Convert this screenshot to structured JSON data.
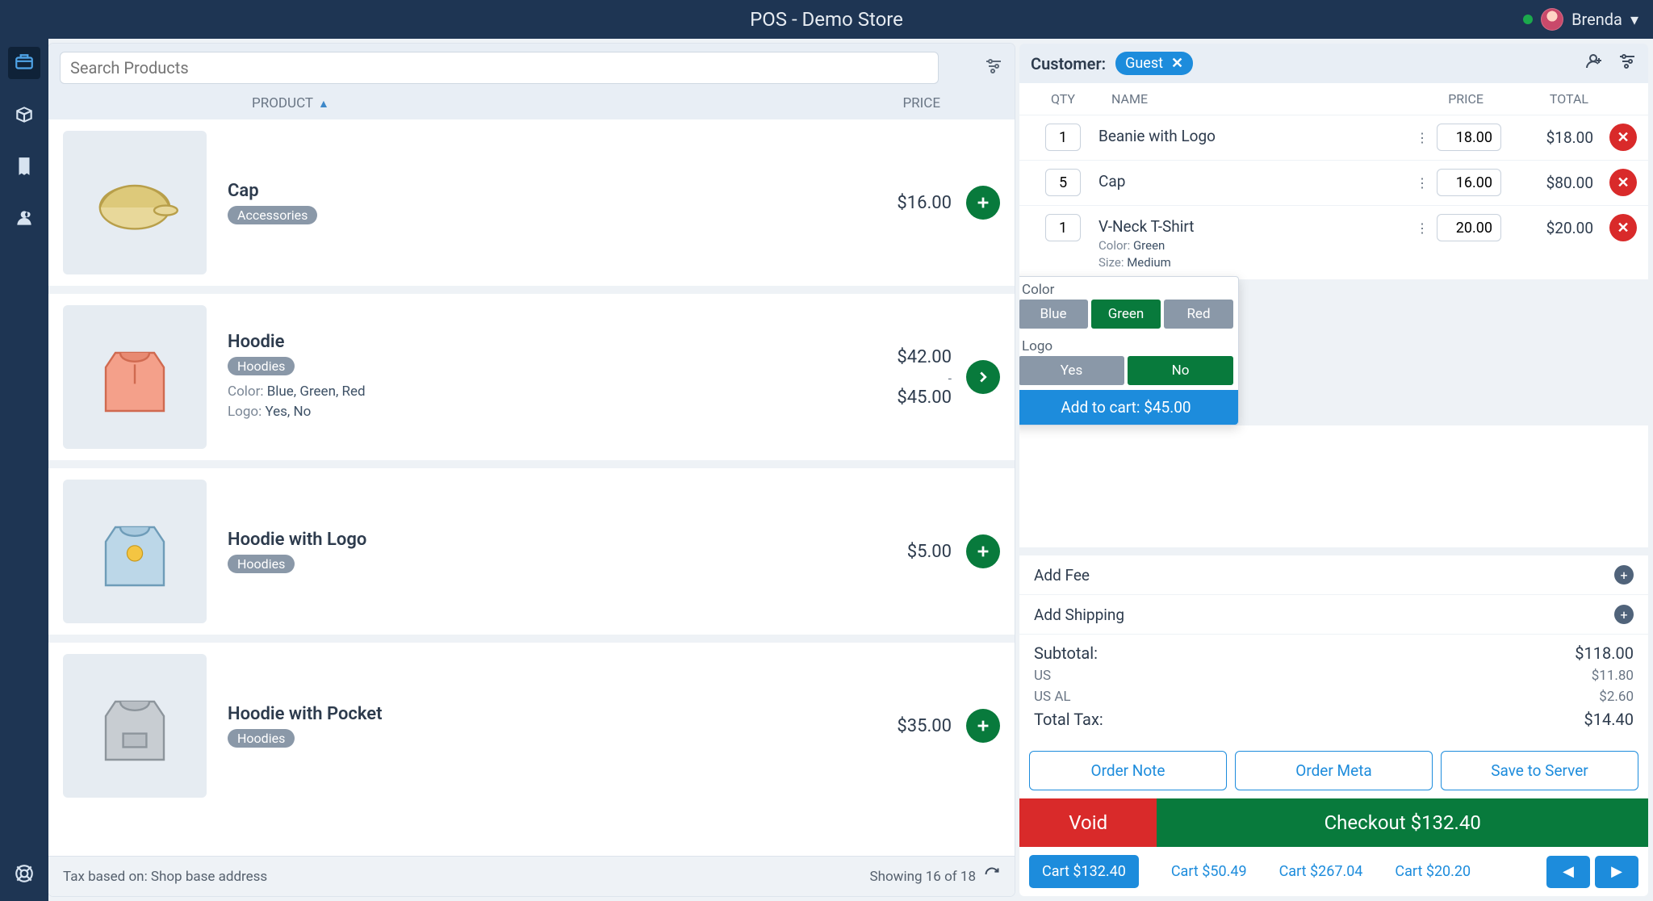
{
  "header": {
    "title": "POS - Demo Store",
    "user": "Brenda"
  },
  "search": {
    "placeholder": "Search Products"
  },
  "sort": {
    "product": "PRODUCT",
    "price": "PRICE"
  },
  "products": [
    {
      "name": "Cap",
      "tag": "Accessories",
      "price": "$16.00",
      "variants": null,
      "action": "add"
    },
    {
      "name": "Hoodie",
      "tag": "Hoodies",
      "price": "$42.00\n-\n$45.00",
      "variants": [
        {
          "label": "Color",
          "values": "Blue, Green, Red"
        },
        {
          "label": "Logo",
          "values": "Yes, No"
        }
      ],
      "action": "more"
    },
    {
      "name": "Hoodie with Logo",
      "tag": "Hoodies",
      "price": "$5.00",
      "variants": null,
      "action": "add"
    },
    {
      "name": "Hoodie with Pocket",
      "tag": "Hoodies",
      "price": "$35.00",
      "variants": null,
      "action": "add"
    }
  ],
  "footer": {
    "tax": "Tax based on: Shop base address",
    "showing": "Showing 16 of 18"
  },
  "customer": {
    "label": "Customer:",
    "name": "Guest"
  },
  "cart_cols": {
    "qty": "QTY",
    "name": "NAME",
    "price": "PRICE",
    "total": "TOTAL"
  },
  "cart_items": [
    {
      "qty": "1",
      "name": "Beanie with Logo",
      "sub": [],
      "price": "18.00",
      "total": "$18.00"
    },
    {
      "qty": "5",
      "name": "Cap",
      "sub": [],
      "price": "16.00",
      "total": "$80.00"
    },
    {
      "qty": "1",
      "name": "V-Neck T-Shirt",
      "sub": [
        {
          "k": "Color:",
          "v": "Green"
        },
        {
          "k": "Size:",
          "v": "Medium"
        }
      ],
      "price": "20.00",
      "total": "$20.00"
    }
  ],
  "variant_popup": {
    "row1_label": "Color",
    "row1_opts": [
      "Blue",
      "Green",
      "Red"
    ],
    "row1_selected": 1,
    "row2_label": "Logo",
    "row2_opts": [
      "Yes",
      "No"
    ],
    "row2_selected": 1,
    "add": "Add to cart: $45.00"
  },
  "extras": {
    "fee": "Add Fee",
    "ship": "Add Shipping"
  },
  "totals": {
    "subtotal_l": "Subtotal:",
    "subtotal_v": "$118.00",
    "us_l": "US",
    "us_v": "$11.80",
    "usal_l": "US AL",
    "usal_v": "$2.60",
    "tax_l": "Total Tax:",
    "tax_v": "$14.40"
  },
  "order_actions": {
    "note": "Order Note",
    "meta": "Order Meta",
    "save": "Save to Server"
  },
  "checkout": {
    "void": "Void",
    "checkout": "Checkout $132.40"
  },
  "carts": {
    "main": "Cart $132.40",
    "others": [
      "Cart $50.49",
      "Cart $267.04",
      "Cart $20.20"
    ]
  }
}
